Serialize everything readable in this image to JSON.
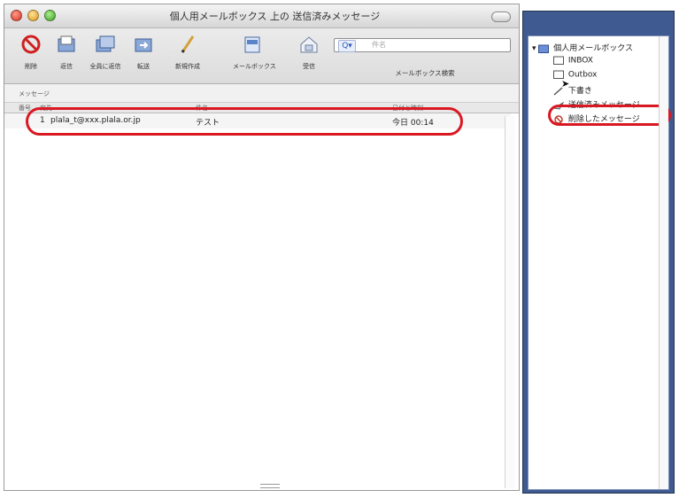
{
  "window": {
    "title": "個人用メールボックス 上の 送信済みメッセージ"
  },
  "toolbar": {
    "buttons": [
      {
        "label": "削除",
        "icon": "prohibit-icon"
      },
      {
        "label": "返信",
        "icon": "mail-icon"
      },
      {
        "label": "全員に返信",
        "icon": "mail-stack-icon"
      },
      {
        "label": "転送",
        "icon": "forward-icon"
      },
      {
        "label": "新規作成",
        "icon": "pencil-icon"
      },
      {
        "label": "メールボックス",
        "icon": "mailbox-icon"
      },
      {
        "label": "受信",
        "icon": "inbox-icon"
      }
    ],
    "search": {
      "placeholder": "件名",
      "label": "メールボックス検索"
    }
  },
  "list": {
    "section_label": "メッセージ",
    "columns": [
      "番号",
      "宛先",
      "件名",
      "日付と時刻"
    ],
    "rows": [
      {
        "num": "1",
        "to": "plala_t@xxx.plala.or.jp",
        "subject": "テスト",
        "date": "今日 00:14"
      }
    ]
  },
  "sidebar": {
    "root": "個人用メールボックス",
    "folders": [
      {
        "label": "INBOX"
      },
      {
        "label": "Outbox"
      },
      {
        "label": "下書き"
      },
      {
        "label": "送信済みメッセージ"
      },
      {
        "label": "削除したメッセージ"
      }
    ]
  },
  "colors": {
    "highlight": "#d91822",
    "drawer_bg": "#3e5a91"
  }
}
